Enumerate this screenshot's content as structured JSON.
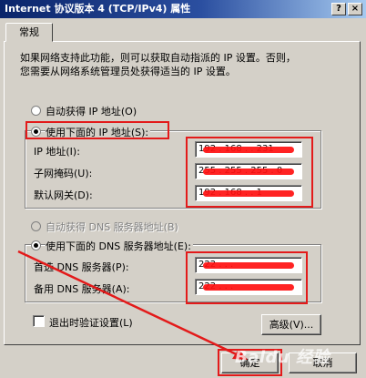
{
  "window": {
    "title": "Internet 协议版本 4 (TCP/IPv4) 属性",
    "help_btn": "?",
    "close_btn": "×"
  },
  "tabs": [
    {
      "label": "常规",
      "active": true
    }
  ],
  "description": [
    "如果网络支持此功能，则可以获取自动指派的 IP 设置。否则，",
    "您需要从网络系统管理员处获得适当的 IP 设置。"
  ],
  "ip_mode": {
    "auto_label": "自动获得 IP 地址(O)",
    "manual_label": "使用下面的 IP 地址(S):",
    "selected": "manual"
  },
  "ip_fields": [
    {
      "label": "IP 地址(I):",
      "value": "192 . 168 .   . 231"
    },
    {
      "label": "子网掩码(U):",
      "value": "255 . 255 . 255 . 0"
    },
    {
      "label": "默认网关(D):",
      "value": "192 . 168 .   . 1"
    }
  ],
  "dns_mode": {
    "auto_label": "自动获得 DNS 服务器地址(B)",
    "manual_label": "使用下面的 DNS 服务器地址(E):",
    "selected": "manual",
    "auto_disabled": true
  },
  "dns_fields": [
    {
      "label": "首选 DNS 服务器(P):",
      "value": "222 .   .   .  "
    },
    {
      "label": "备用 DNS 服务器(A):",
      "value": "222 .   .   .  "
    }
  ],
  "validate": {
    "label": "退出时验证设置(L)",
    "checked": false
  },
  "advanced_label": "高级(V)...",
  "ok_label": "确定",
  "cancel_label": "取消",
  "watermark": "Baidu 经验",
  "colors": {
    "annotation_red": "#e31a1a",
    "titlebar_start": "#0a246a",
    "titlebar_end": "#a6caf0"
  }
}
